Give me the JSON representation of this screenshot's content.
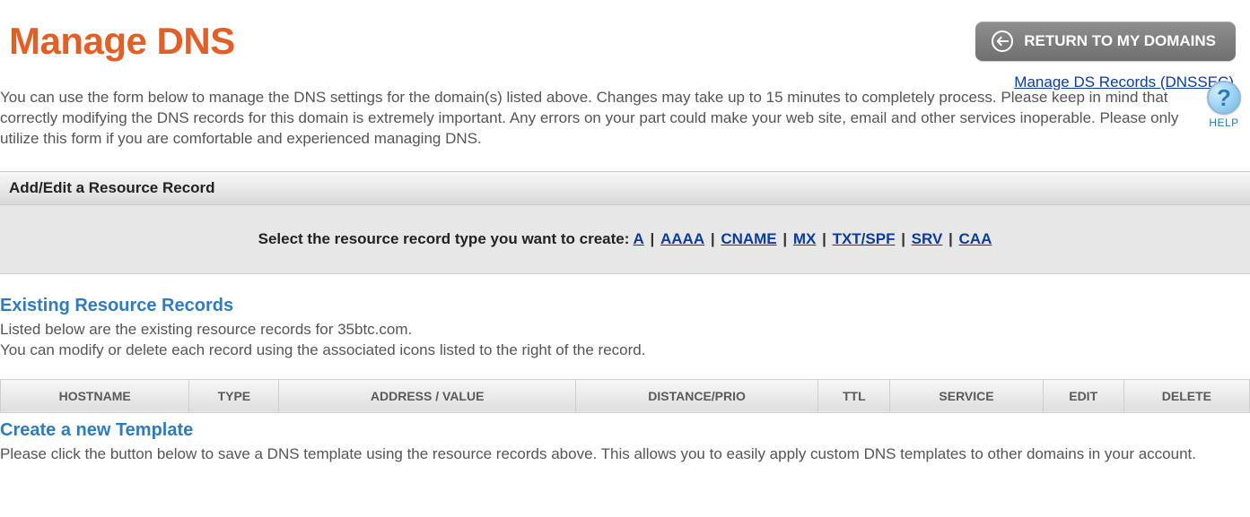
{
  "header": {
    "title": "Manage DNS",
    "return_label": "RETURN TO MY DOMAINS",
    "dnssec_link": "Manage DS Records (DNSSEC)"
  },
  "intro": {
    "text": "You can use the form below to manage the DNS settings for the domain(s) listed above. Changes may take up to 15 minutes to completely process. Please keep in mind that correctly modifying the DNS records for this domain is extremely important. Any errors on your part could make your web site, email and other services inoperable. Please only utilize this form if you are comfortable and experienced managing DNS.",
    "help_label": "HELP"
  },
  "add_section": {
    "bar_title": "Add/Edit a Resource Record",
    "select_lead": "Select the resource record type you want to create: ",
    "types": [
      "A",
      "AAAA",
      "CNAME",
      "MX",
      "TXT/SPF",
      "SRV",
      "CAA"
    ]
  },
  "existing": {
    "heading": "Existing Resource Records",
    "line1": "Listed below are the existing resource records for 35btc.com.",
    "line2": "You can modify or delete each record using the associated icons listed to the right of the record.",
    "columns": [
      "HOSTNAME",
      "TYPE",
      "ADDRESS / VALUE",
      "DISTANCE/PRIO",
      "TTL",
      "SERVICE",
      "EDIT",
      "DELETE"
    ]
  },
  "template": {
    "heading": "Create a new Template",
    "text": "Please click the button below to save a DNS template using the resource records above. This allows you to easily apply custom DNS templates to other domains in your account."
  }
}
